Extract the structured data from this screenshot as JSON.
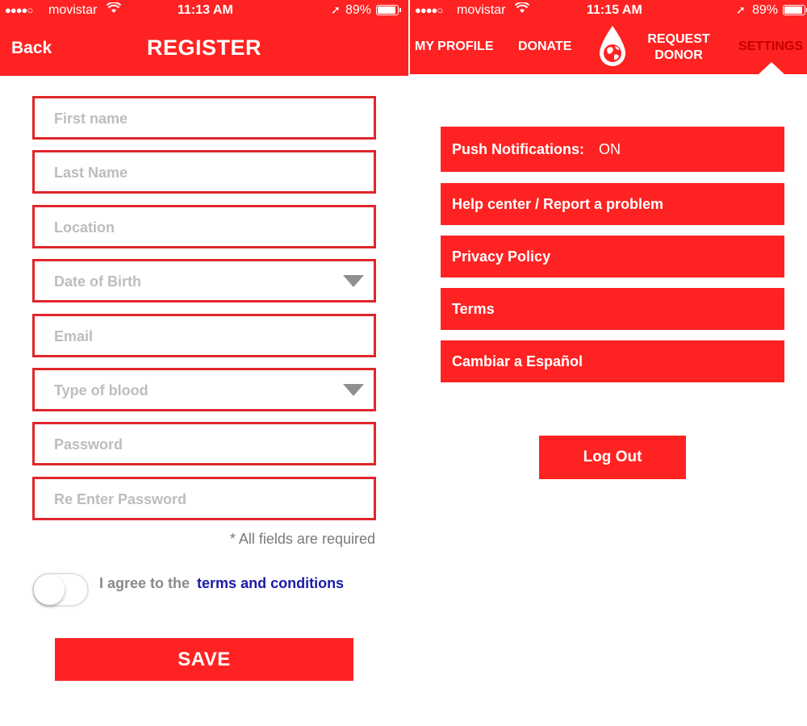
{
  "colors": {
    "accent": "#ff2222",
    "field_border": "#e0262b",
    "link": "#1a1aa8"
  },
  "left": {
    "status": {
      "carrier": "movistar",
      "time": "11:13 AM",
      "battery": "89%"
    },
    "header": {
      "back": "Back",
      "title": "REGISTER"
    },
    "fields": [
      {
        "placeholder": "First name",
        "dropdown": false
      },
      {
        "placeholder": "Last Name",
        "dropdown": false
      },
      {
        "placeholder": "Location",
        "dropdown": false
      },
      {
        "placeholder": "Date of Birth",
        "dropdown": true
      },
      {
        "placeholder": "Email",
        "dropdown": false
      },
      {
        "placeholder": "Type of blood",
        "dropdown": true
      },
      {
        "placeholder": "Password",
        "dropdown": false
      },
      {
        "placeholder": "Re Enter Password",
        "dropdown": false
      }
    ],
    "required_note": "* All fields are required",
    "agree": {
      "text": "I agree to the",
      "link": "terms and conditions",
      "toggle_on": false
    },
    "save": "SAVE"
  },
  "right": {
    "status": {
      "carrier": "movistar",
      "time": "11:15 AM",
      "battery": "89%"
    },
    "nav": {
      "my_profile": "MY PROFILE",
      "donate": "DONATE",
      "request_line1": "REQUEST",
      "request_line2": "DONOR",
      "settings": "SETTINGS",
      "logo_icon": "blood-drop-globe-icon"
    },
    "settings": {
      "push_label": "Push Notifications:",
      "push_value": "ON",
      "help": "Help center / Report a problem",
      "privacy": "Privacy Policy",
      "terms": "Terms",
      "language": "Cambiar a Español"
    },
    "logout": "Log Out"
  }
}
